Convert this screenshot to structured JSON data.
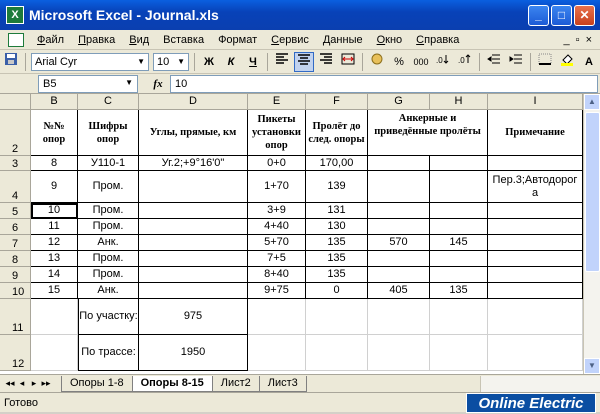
{
  "window": {
    "title": "Microsoft Excel - Journal.xls",
    "app_icon_letter": "X",
    "min_glyph": "_",
    "max_glyph": "□",
    "close_glyph": "✕"
  },
  "menu": {
    "items": [
      {
        "first": "Ф",
        "rest": "айл"
      },
      {
        "first": "П",
        "rest": "равка"
      },
      {
        "first": "В",
        "rest": "ид"
      },
      {
        "first": "Вст",
        "rest": "авка"
      },
      {
        "first": "Фор",
        "rest": "мат"
      },
      {
        "first": "С",
        "rest": "ервис"
      },
      {
        "first": "Д",
        "rest": "анные"
      },
      {
        "first": "О",
        "rest": "кно"
      },
      {
        "first": "С",
        "rest": "правка"
      }
    ],
    "doc_controls": [
      "_",
      "▫",
      "×"
    ]
  },
  "toolbar": {
    "font_name": "Arial Cyr",
    "font_size": "10",
    "bold": "Ж",
    "italic": "К",
    "underline": "Ч",
    "percent": "%",
    "thousands": "000",
    "font_color": "A",
    "icons": [
      "save-icon",
      "bold-icon",
      "italic-icon",
      "underline-icon",
      "align-left-icon",
      "align-center-icon",
      "align-right-icon",
      "merge-icon",
      "currency-icon",
      "percent-icon",
      "thousands-icon",
      "decimal-increase-icon",
      "decimal-decrease-icon",
      "indent-decrease-icon",
      "indent-increase-icon",
      "borders-icon",
      "fill-color-icon",
      "font-color-icon"
    ]
  },
  "formula_bar": {
    "name_box": "B5",
    "fx": "fx",
    "value": "10"
  },
  "colors": {
    "accent": "#0a5fe0",
    "active_header": "#f9d28b",
    "watermark_bg": "#0b4ea2"
  },
  "columns": [
    "B",
    "C",
    "D",
    "E",
    "F",
    "G",
    "H",
    "I"
  ],
  "rows": [
    "2",
    "3",
    "4",
    "5",
    "6",
    "7",
    "8",
    "9",
    "10",
    "11",
    "12"
  ],
  "header": {
    "B": "№№ опор",
    "C": "Шифры опор",
    "D": "Углы, прямые, км",
    "E": "Пикеты установки опор",
    "F": "Пролёт до след. опоры",
    "GH": "Анкерные и приведённые пролёты",
    "I": "Примечание"
  },
  "cells": {
    "B3": "8",
    "C3": "У110-1",
    "D3": "Уг.2;+9°16'0\"",
    "E3": "0+0",
    "F3": "170,00",
    "B4": "9",
    "C4": "Пром.",
    "E4": "1+70",
    "F4": "139",
    "I4": "Пер.3;Автодорога",
    "B5": "10",
    "C5": "Пром.",
    "E5": "3+9",
    "F5": "131",
    "B6": "11",
    "C6": "Пром.",
    "E6": "4+40",
    "F6": "130",
    "B7": "12",
    "C7": "Анк.",
    "E7": "5+70",
    "F7": "135",
    "G7": "570",
    "H7": "145",
    "B8": "13",
    "C8": "Пром.",
    "E8": "7+5",
    "F8": "135",
    "B9": "14",
    "C9": "Пром.",
    "E9": "8+40",
    "F9": "135",
    "B10": "15",
    "C10": "Анк.",
    "E10": "9+75",
    "F10": "0",
    "G10": "405",
    "H10": "135",
    "C11": "По участку:",
    "D11": "975",
    "C12": "По трассе:",
    "D12": "1950"
  },
  "sheet_tabs": [
    "Опоры 1-8",
    "Опоры 8-15",
    "Лист2",
    "Лист3"
  ],
  "active_tab": 1,
  "tab_nav": [
    "◂◂",
    "◂",
    "▸",
    "▸▸"
  ],
  "status": {
    "text": "Готово",
    "watermark": "Online Electric"
  }
}
